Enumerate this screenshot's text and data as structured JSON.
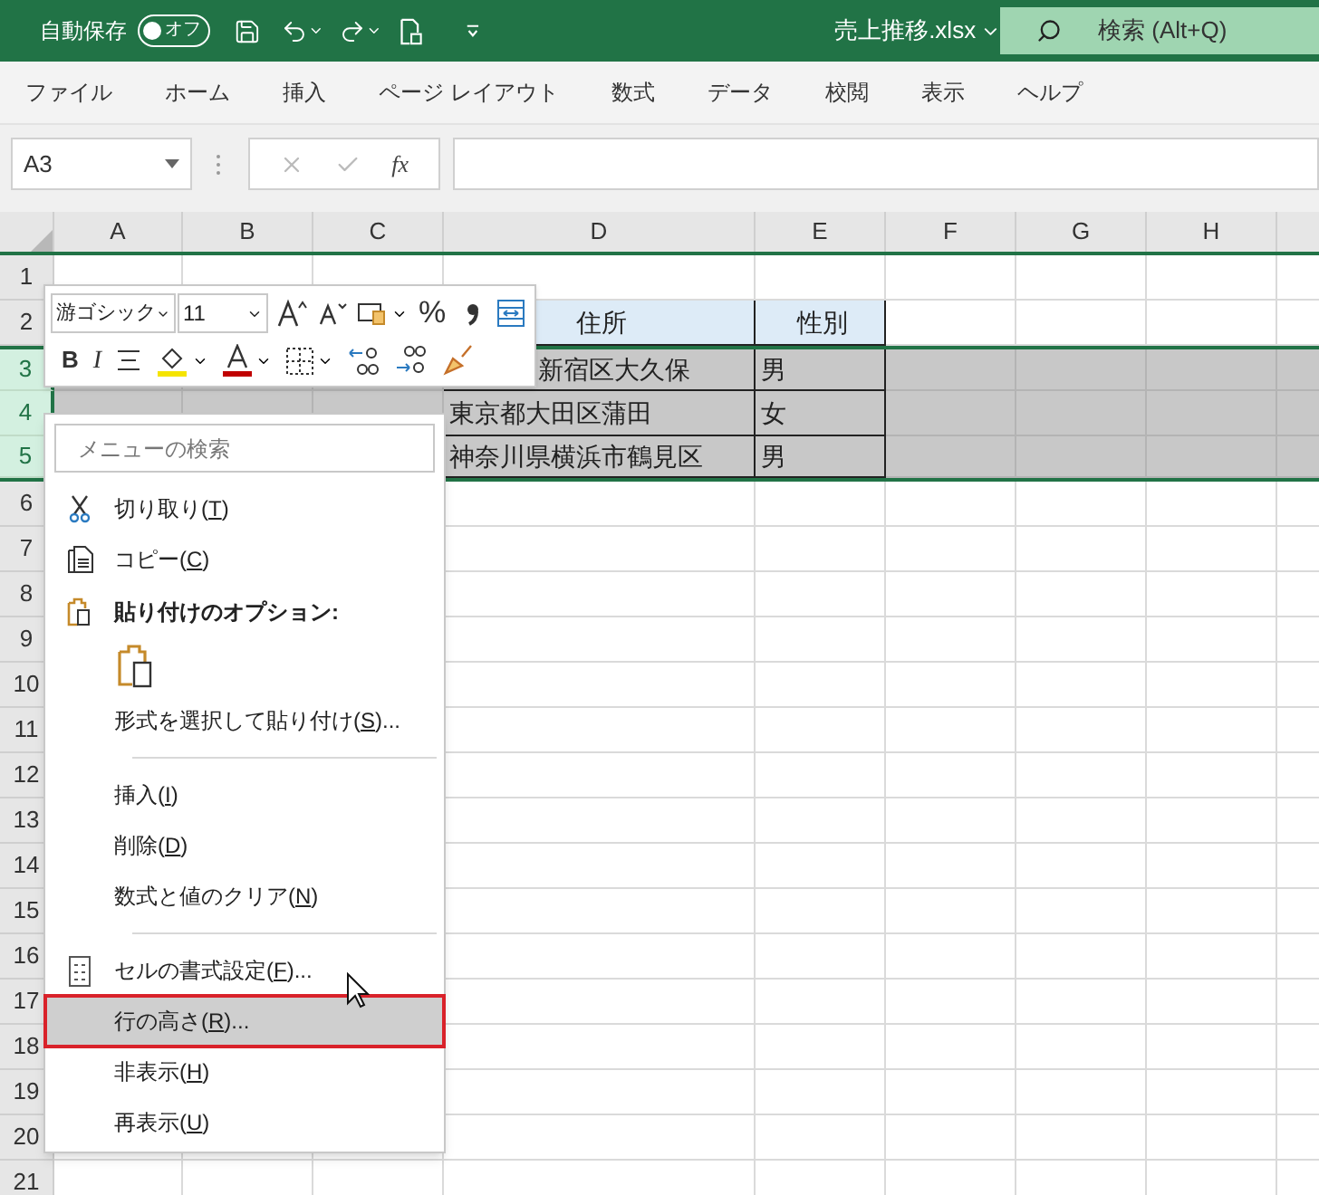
{
  "title_bar": {
    "autosave_label": "自動保存",
    "autosave_toggle": {
      "label": "オフ",
      "on": false
    },
    "file_name": "売上推移.xlsx",
    "search": {
      "placeholder": "検索 (Alt+Q)"
    }
  },
  "menu_tabs": [
    "ファイル",
    "ホーム",
    "挿入",
    "ページ レイアウト",
    "数式",
    "データ",
    "校閲",
    "表示",
    "ヘルプ"
  ],
  "formula_bar": {
    "name_box": "A3",
    "function_label": "fx"
  },
  "sheet": {
    "columns": [
      "A",
      "B",
      "C",
      "D",
      "E",
      "F",
      "G",
      "H"
    ],
    "rows": [
      {
        "number": "1",
        "selected": false,
        "cells": {}
      },
      {
        "number": "2",
        "selected": false,
        "cells": {
          "D": {
            "text": "住所",
            "kind": "heading"
          },
          "E": {
            "text": "性別",
            "kind": "heading"
          }
        }
      },
      {
        "number": "3",
        "selected": true,
        "cells": {
          "D": {
            "text": "新宿区大久保",
            "kind": "partial"
          },
          "E": {
            "text": "男",
            "kind": "data"
          }
        }
      },
      {
        "number": "4",
        "selected": true,
        "cells": {
          "D": {
            "text": "東京都大田区蒲田",
            "kind": "data"
          },
          "E": {
            "text": "女",
            "kind": "data"
          }
        }
      },
      {
        "number": "5",
        "selected": true,
        "cells": {
          "D": {
            "text": "神奈川県横浜市鶴見区",
            "kind": "data"
          },
          "E": {
            "text": "男",
            "kind": "data"
          }
        }
      },
      {
        "number": "6",
        "selected": false,
        "cells": {}
      },
      {
        "number": "7",
        "selected": false,
        "cells": {}
      },
      {
        "number": "8",
        "selected": false,
        "cells": {}
      },
      {
        "number": "9",
        "selected": false,
        "cells": {}
      },
      {
        "number": "10",
        "selected": false,
        "cells": {}
      },
      {
        "number": "11",
        "selected": false,
        "cells": {}
      },
      {
        "number": "12",
        "selected": false,
        "cells": {}
      },
      {
        "number": "13",
        "selected": false,
        "cells": {}
      },
      {
        "number": "14",
        "selected": false,
        "cells": {}
      },
      {
        "number": "15",
        "selected": false,
        "cells": {}
      },
      {
        "number": "16",
        "selected": false,
        "cells": {}
      },
      {
        "number": "17",
        "selected": false,
        "cells": {}
      },
      {
        "number": "18",
        "selected": false,
        "cells": {}
      },
      {
        "number": "19",
        "selected": false,
        "cells": {}
      },
      {
        "number": "20",
        "selected": false,
        "cells": {}
      },
      {
        "number": "21",
        "selected": false,
        "cells": {}
      }
    ]
  },
  "mini_toolbar": {
    "font": "游ゴシック",
    "size": "11",
    "bold": "B",
    "italic": "I",
    "percent": "%"
  },
  "context_menu": [
    {
      "kind": "search",
      "placeholder": "メニューの検索"
    },
    {
      "kind": "cut",
      "label": "切り取り(",
      "key": "T",
      "tail": ")",
      "selected": false
    },
    {
      "kind": "copy",
      "label": "コピー(",
      "key": "C",
      "tail": ")",
      "selected": false
    },
    {
      "kind": "heading",
      "label": "貼り付けのオプション:"
    },
    {
      "kind": "paste"
    },
    {
      "kind": "command",
      "label": "形式を選択して貼り付け(",
      "key": "S",
      "tail": ")...",
      "selected": false
    },
    {
      "kind": "separator"
    },
    {
      "kind": "command",
      "label": "挿入(",
      "key": "I",
      "tail": ")",
      "selected": false
    },
    {
      "kind": "command",
      "label": "削除(",
      "key": "D",
      "tail": ")",
      "selected": false
    },
    {
      "kind": "command",
      "label": "数式と値のクリア(",
      "key": "N",
      "tail": ")",
      "selected": false
    },
    {
      "kind": "separator"
    },
    {
      "kind": "format",
      "label": "セルの書式設定(",
      "key": "F",
      "tail": ")...",
      "selected": false
    },
    {
      "kind": "command",
      "label": "行の高さ(",
      "key": "R",
      "tail": ")...",
      "selected": true
    },
    {
      "kind": "command",
      "label": "非表示(",
      "key": "H",
      "tail": ")",
      "selected": false
    },
    {
      "kind": "command",
      "label": "再表示(",
      "key": "U",
      "tail": ")",
      "selected": false
    }
  ]
}
